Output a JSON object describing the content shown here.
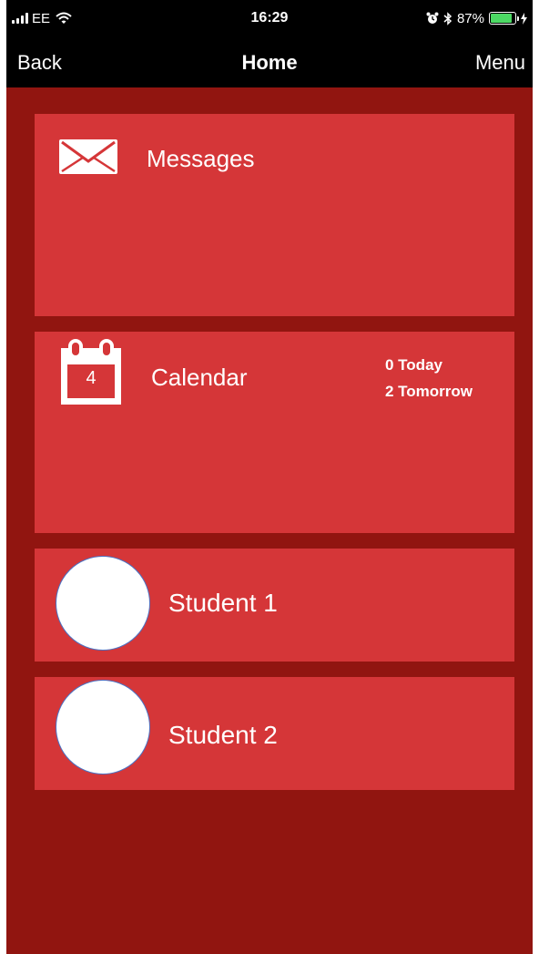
{
  "status_bar": {
    "carrier": "EE",
    "time": "16:29",
    "battery_percent": "87%",
    "battery_level": 0.87,
    "battery_color": "#4cd964",
    "icons": [
      "signal-icon",
      "wifi-icon",
      "alarm-icon",
      "bluetooth-icon",
      "battery-icon",
      "charging-icon"
    ]
  },
  "nav": {
    "back_label": "Back",
    "title": "Home",
    "menu_label": "Menu"
  },
  "tiles": {
    "messages": {
      "label": "Messages",
      "icon": "envelope-icon"
    },
    "calendar": {
      "label": "Calendar",
      "icon": "calendar-icon",
      "day": "4",
      "today": "0 Today",
      "tomorrow": "2 Tomorrow"
    },
    "students": [
      {
        "label": "Student 1",
        "icon": "avatar"
      },
      {
        "label": "Student 2",
        "icon": "avatar"
      }
    ]
  },
  "colors": {
    "background": "#911510",
    "tile": "#d53638",
    "bar": "#000000",
    "text": "#ffffff"
  }
}
